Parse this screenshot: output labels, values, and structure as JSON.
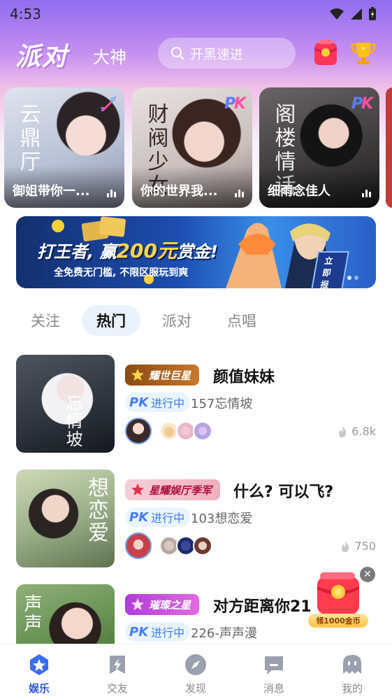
{
  "status_bar": {
    "time": "4:53"
  },
  "header": {
    "tab_party": "派对",
    "tab_god": "大神",
    "search_placeholder": "开黑速进"
  },
  "featured_rooms": [
    {
      "name": "御姐带你一...",
      "deco": "云鼎厅",
      "badge": "rocket"
    },
    {
      "name": "你的世界我...",
      "deco": "财阀少女",
      "badge": "PK"
    },
    {
      "name": "细雨念佳人",
      "deco": "阁楼情话",
      "badge": "PK"
    }
  ],
  "banner": {
    "title_pre": "打王者, 赢",
    "title_amount": "200元",
    "title_post": "赏金!",
    "subtitle": "全免费无门槛, 不限区服玩到爽",
    "cta": "立即报名"
  },
  "tabs": [
    {
      "label": "关注"
    },
    {
      "label": "热门",
      "active": true
    },
    {
      "label": "派对"
    },
    {
      "label": "点唱"
    }
  ],
  "room_list": [
    {
      "badge": "耀世巨星",
      "title": "颜值妹妹",
      "pk_label": "PK",
      "status": "进行中",
      "room_name": "157忘情坡",
      "heat": "6.8k",
      "cover_text": "忘情坡"
    },
    {
      "badge": "星耀娱厅季军",
      "title": "什么? 可以飞?",
      "pk_label": "PK",
      "status": "进行中",
      "room_name": "103想恋爱",
      "heat": "750",
      "cover_text": "想恋爱"
    },
    {
      "badge": "璀璨之星",
      "title": "对方距离你21",
      "pk_label": "PK",
      "status": "进行中",
      "room_name": "226-声声漫",
      "heat": "",
      "cover_text": "声声"
    }
  ],
  "floating_gift": {
    "label": "领1000金币"
  },
  "bottom_nav": [
    {
      "label": "娱乐",
      "icon": "star-icon",
      "active": true
    },
    {
      "label": "交友",
      "icon": "friend-icon"
    },
    {
      "label": "发现",
      "icon": "compass-icon"
    },
    {
      "label": "消息",
      "icon": "message-icon"
    },
    {
      "label": "我的",
      "icon": "ghost-icon"
    }
  ],
  "colors": {
    "accent": "#2e56e0",
    "pk_blue": "#4a7cff",
    "hero_purple": "#8f6cf0"
  }
}
